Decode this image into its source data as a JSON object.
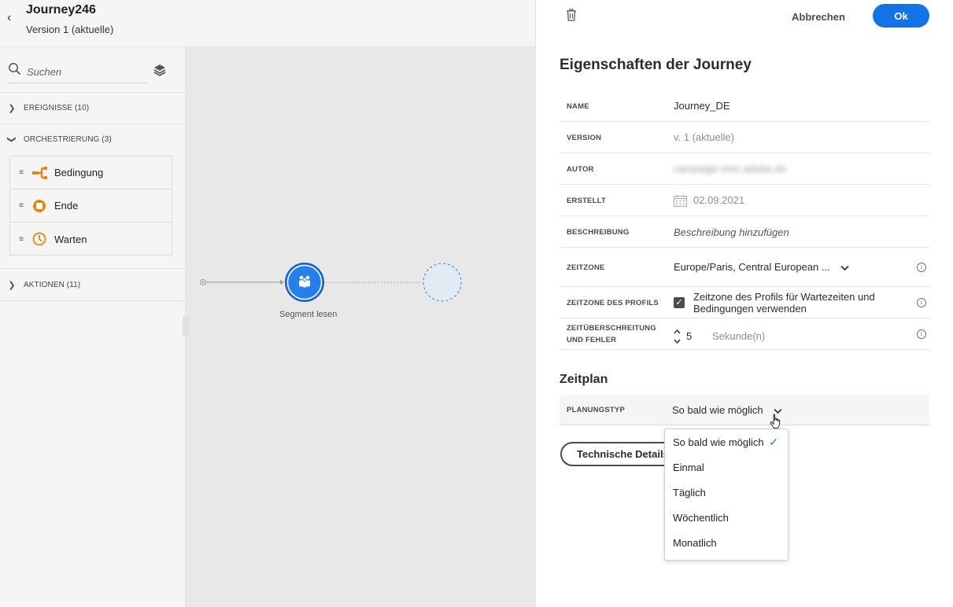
{
  "header": {
    "journey_name": "Journey246",
    "version": "Version 1 (aktuelle)"
  },
  "palette": {
    "search_placeholder": "Suchen",
    "sections": {
      "events": "EREIGNISSE (10)",
      "orchestration": "ORCHESTRIERUNG (3)",
      "actions": "AKTIONEN (11)"
    },
    "orchestration_items": [
      {
        "label": "Bedingung",
        "icon": "condition-icon",
        "color": "#e68619"
      },
      {
        "label": "Ende",
        "icon": "end-icon",
        "color": "#e68619"
      },
      {
        "label": "Warten",
        "icon": "wait-icon",
        "color": "#e68619"
      }
    ]
  },
  "canvas": {
    "node_label": "Segment lesen",
    "node_color": "#2680eb"
  },
  "panel": {
    "cancel_label": "Abbrechen",
    "ok_label": "Ok",
    "title": "Eigenschaften der Journey",
    "properties": {
      "name_label": "NAME",
      "name_value": "Journey_DE",
      "version_label": "VERSION",
      "version_value": "v. 1 (aktuelle)",
      "author_label": "AUTOR",
      "author_value": "campaign-mnc.adobe.de",
      "created_label": "ERSTELLT",
      "created_value": "02.09.2021",
      "description_label": "BESCHREIBUNG",
      "description_placeholder": "Beschreibung hinzufügen",
      "timezone_label": "ZEITZONE",
      "timezone_value": "Europe/Paris, Central European ...",
      "profile_tz_label": "ZEITZONE DES PROFILS",
      "profile_tz_text": "Zeitzone des Profils für Wartezeiten und Bedingungen verwenden",
      "timeout_label": "ZEITÜBERSCHREITUNG UND FEHLER",
      "timeout_value": "5",
      "timeout_unit": "Sekunde(n)"
    },
    "schedule": {
      "title": "Zeitplan",
      "type_label": "PLANUNGSTYP",
      "type_value": "So bald wie möglich",
      "options": [
        "So bald wie möglich",
        "Einmal",
        "Täglich",
        "Wöchentlich",
        "Monatlich"
      ],
      "selected_index": 0
    },
    "tech_details_label": "Technische Details"
  },
  "colors": {
    "accent": "#1473e6",
    "orchestration": "#e68619"
  }
}
